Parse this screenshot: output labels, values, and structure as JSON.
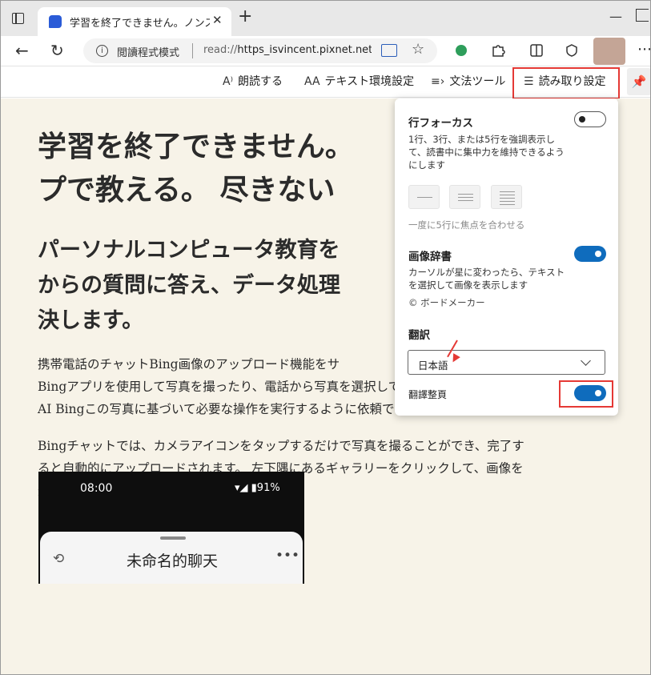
{
  "tab": {
    "title": "学習を終了できません。ノンス",
    "close": "✕",
    "new_tab": "+"
  },
  "window": {
    "minimize": "—"
  },
  "address_bar": {
    "mode": "閲讀程式模式",
    "url_prefix": "read://",
    "url_host": "https_isvincent.pixnet.net..."
  },
  "reader_toolbar": {
    "read_aloud": "朗読する",
    "text_prefs": "テキスト環境設定",
    "grammar_tools": "文法ツール",
    "reading_prefs": "読み取り設定"
  },
  "article": {
    "title": "学習を終了できません。\nプで教える。 尽きない",
    "subtitle": "パーソナルコンピュータ教育を\nからの質問に答え、データ処理\n決します。",
    "para1": "携帯電話のチャットBing画像のアップロード機能をサ\nBingアプリを使用して写真を撮ったり、電話から写真を選択してアップロードしたり、\nAI Bingこの写真に基づいて必要な操作を実行するように依頼できます。",
    "para2": "Bingチャットでは、カメラアイコンをタップするだけで写真を撮ることができ、完了す\nると自動的にアップロードされます。 左下隅にあるギャラリーをクリックして、画像を\n選択してアップロードすることもできます。"
  },
  "phone": {
    "time": "08:00",
    "status": "▾◢ ▮91%",
    "chat_title": "未命名的聊天",
    "more": "•••"
  },
  "panel": {
    "line_focus_title": "行フォーカス",
    "line_focus_desc": "1行、3行、または5行を強調表示して、読書中に集中力を維持できるようにします",
    "line_focus_hint": "一度に5行に焦点を合わせる",
    "picture_dict_title": "画像辞書",
    "picture_dict_desc": "カーソルが星に変わったら、テキストを選択して画像を表示します",
    "picture_dict_credit": "© ボードメーカー",
    "translate_title": "翻訳",
    "translate_lang": "日本語",
    "translate_full": "翻譯整頁"
  },
  "states": {
    "line_focus": false,
    "picture_dict": true,
    "translate_full": true
  },
  "colors": {
    "accent": "#0f6cbd",
    "highlight": "#e53935",
    "reader_bg": "#f7f3e8"
  }
}
